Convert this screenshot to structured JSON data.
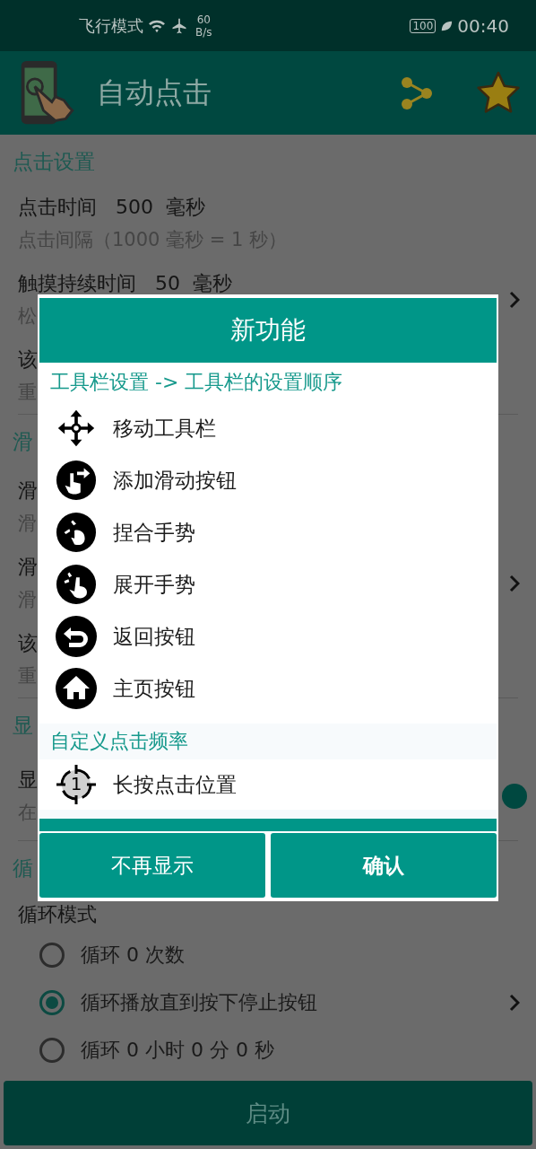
{
  "status_bar": {
    "mode": "飞行模式",
    "speed_value": "60",
    "speed_unit": "B/s",
    "battery": "100",
    "time": "00:40"
  },
  "app_bar": {
    "title": "自动点击"
  },
  "background": [
    {
      "kind": "section",
      "text": "点击设置"
    },
    {
      "kind": "item",
      "title": "点击时间   500  毫秒",
      "subtitle": "点击间隔（1000 毫秒 = 1 秒）",
      "chevron": false
    },
    {
      "kind": "item",
      "title": "触摸持续时间   50  毫秒",
      "subtitle": "松",
      "chevron": true
    },
    {
      "kind": "item",
      "title": "该",
      "subtitle": "重",
      "chevron": false
    },
    {
      "kind": "section",
      "text": "滑"
    },
    {
      "kind": "item",
      "title": "滑",
      "subtitle": "滑",
      "chevron": false
    },
    {
      "kind": "item",
      "title": "滑",
      "subtitle": "滑",
      "chevron": true
    },
    {
      "kind": "item",
      "title": "该",
      "subtitle": "重",
      "chevron": false
    },
    {
      "kind": "section",
      "text": "显"
    },
    {
      "kind": "item",
      "title": "显",
      "subtitle": "在",
      "chevron": false,
      "switch": {
        "on": true
      }
    },
    {
      "kind": "section",
      "text": "循"
    },
    {
      "kind": "label",
      "text": "循环模式"
    },
    {
      "kind": "radio",
      "text": "循环 0 次数",
      "selected": false,
      "chevron": false
    },
    {
      "kind": "radio",
      "text": "循环播放直到按下停止按钮",
      "selected": true,
      "chevron": true
    },
    {
      "kind": "radio",
      "text": "循环 0 小时 0 分 0 秒",
      "selected": false,
      "chevron": false
    }
  ],
  "start_button": "启动",
  "dialog": {
    "title": "新功能",
    "groups": [
      {
        "heading": "工具栏设置 -> 工具栏的设置顺序",
        "items": [
          {
            "kind": "move",
            "label": "移动工具栏"
          },
          {
            "kind": "swipe",
            "label": "添加滑动按钮"
          },
          {
            "kind": "pinch",
            "label": "捏合手势"
          },
          {
            "kind": "spread",
            "label": "展开手势"
          },
          {
            "kind": "back",
            "label": "返回按钮"
          },
          {
            "kind": "home",
            "label": "主页按钮"
          }
        ]
      },
      {
        "heading": "自定义点击频率",
        "items": [
          {
            "kind": "target",
            "label": "长按点击位置",
            "number": "1"
          }
        ]
      }
    ],
    "buttons": [
      "不再显示",
      "确认"
    ]
  }
}
